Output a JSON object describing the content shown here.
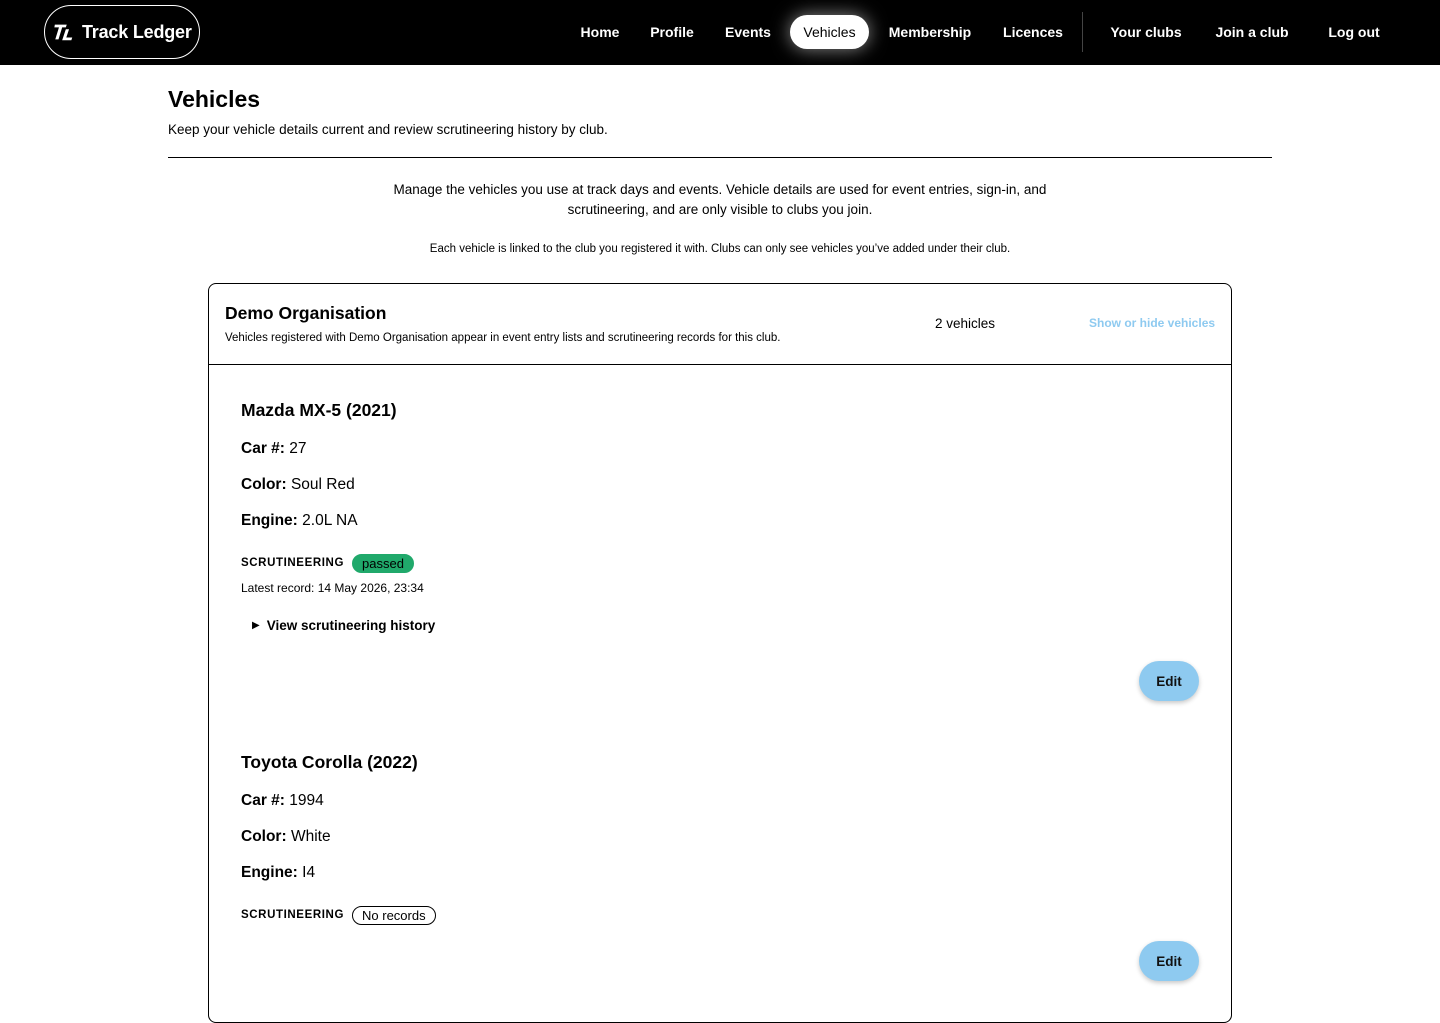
{
  "brand": {
    "name": "Track Ledger",
    "mark": "TL"
  },
  "nav": {
    "items": [
      {
        "label": "Home"
      },
      {
        "label": "Profile"
      },
      {
        "label": "Events"
      },
      {
        "label": "Vehicles"
      },
      {
        "label": "Membership"
      },
      {
        "label": "Licences"
      },
      {
        "label": "Your clubs"
      },
      {
        "label": "Join a club"
      },
      {
        "label": "Log out"
      }
    ],
    "active": "Vehicles"
  },
  "page": {
    "title": "Vehicles",
    "subtitle": "Keep your vehicle details current and review scrutineering history by club.",
    "intro": "Manage the vehicles you use at track days and events. Vehicle details are used for event entries, sign-in, and scrutineering, and are only visible to clubs you join.",
    "note": "Each vehicle is linked to the club you registered it with. Clubs can only see vehicles you’ve added under their club."
  },
  "club": {
    "name": "Demo Organisation",
    "description": "Vehicles registered with Demo Organisation appear in event entry lists and scrutineering records for this club.",
    "vehicle_count": "2 vehicles",
    "toggle_label": "Show or hide vehicles",
    "vehicles": [
      {
        "title": "Mazda MX-5 (2021)",
        "car_number_label": "Car #:",
        "car_number": "27",
        "color_label": "Color:",
        "color": "Soul Red",
        "engine_label": "Engine:",
        "engine": "2.0L NA",
        "scrutineering_label": "SCRUTINEERING",
        "status": "passed",
        "latest_record": "Latest record: 14 May 2026, 23:34",
        "history_label": "View scrutineering history",
        "edit_label": "Edit"
      },
      {
        "title": "Toyota Corolla (2022)",
        "car_number_label": "Car #:",
        "car_number": "1994",
        "color_label": "Color:",
        "color": "White",
        "engine_label": "Engine:",
        "engine": "I4",
        "scrutineering_label": "SCRUTINEERING",
        "status": "No records",
        "edit_label": "Edit"
      }
    ]
  },
  "colors": {
    "nav_background": "#000000",
    "accent": "#8ecaf0",
    "status_passed": "#20a96b"
  },
  "icons": {
    "brand": "tl-monogram-icon",
    "disclosure": "triangle-right-icon"
  }
}
